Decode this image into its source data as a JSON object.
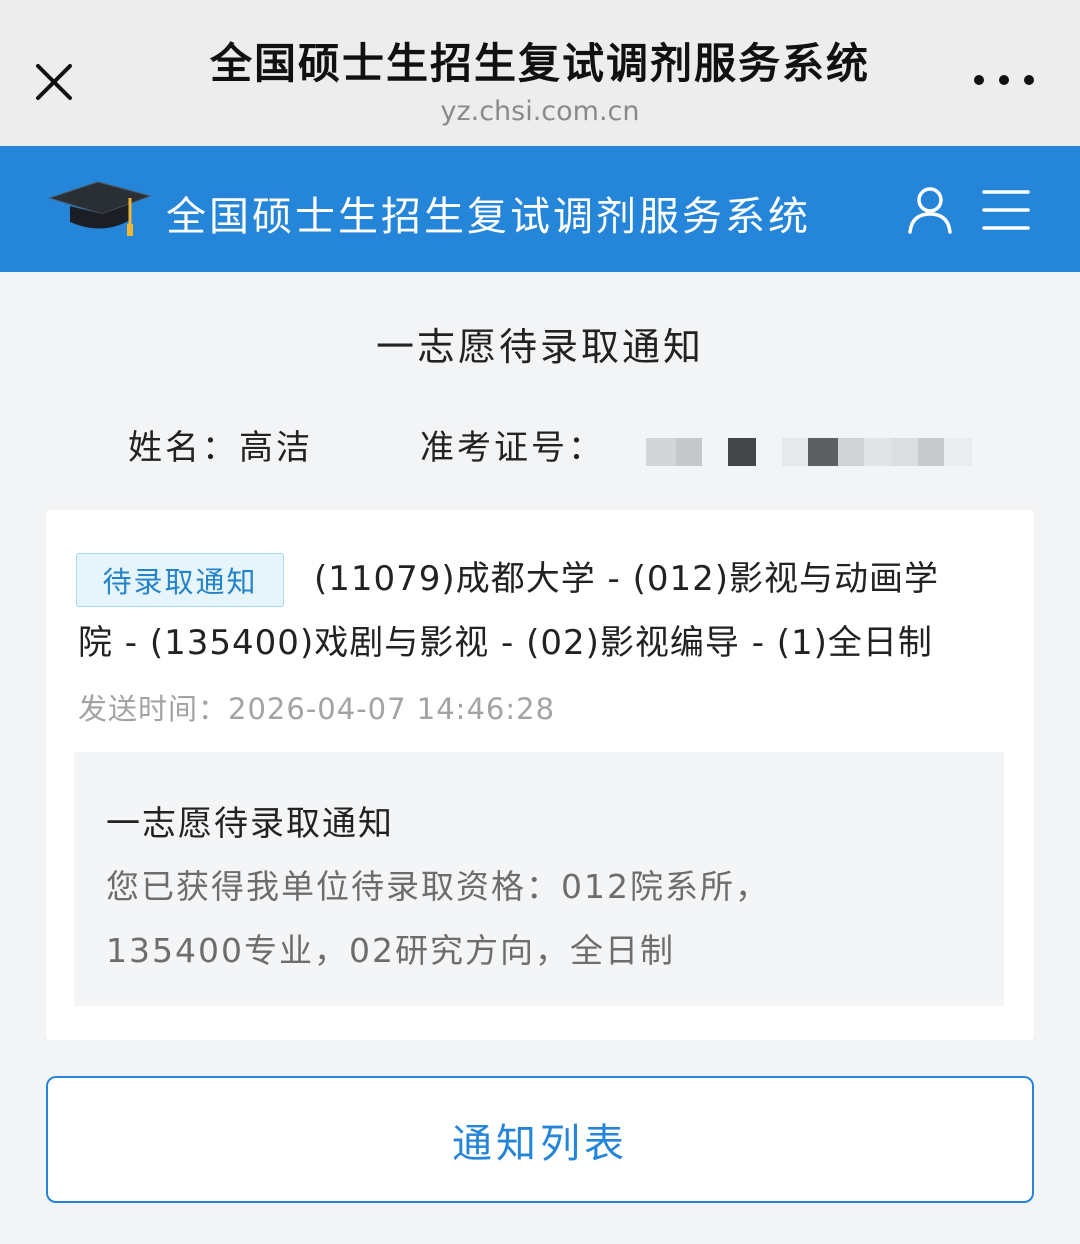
{
  "topbar": {
    "title": "全国硕士生招生复试调剂服务系统",
    "url": "yz.chsi.com.cn"
  },
  "header": {
    "site_title": "全国硕士生招生复试调剂服务系统",
    "logo_icon": "graduation-cap-icon",
    "user_icon": "user-icon",
    "menu_icon": "hamburger-menu-icon",
    "brand_color": "#2585d9"
  },
  "page": {
    "title": "一志愿待录取通知",
    "name_label": "姓名：",
    "name_value": "高洁",
    "ticket_label": "准考证号："
  },
  "notice": {
    "badge": "待录取通知",
    "program_line1": "(11079)成都大学 - (012)影视与动画学",
    "program_line2": "院 - (135400)戏剧与影视 - (02)影视编导 - (1)全日制",
    "send_time_label": "发送时间：",
    "send_time_value": "2026-04-07 14:46:28",
    "detail_title": "一志愿待录取通知",
    "detail_line1": "您已获得我单位待录取资格：012院系所，",
    "detail_line2": "135400专业，02研究方向，全日制"
  },
  "actions": {
    "list_button": "通知列表"
  }
}
